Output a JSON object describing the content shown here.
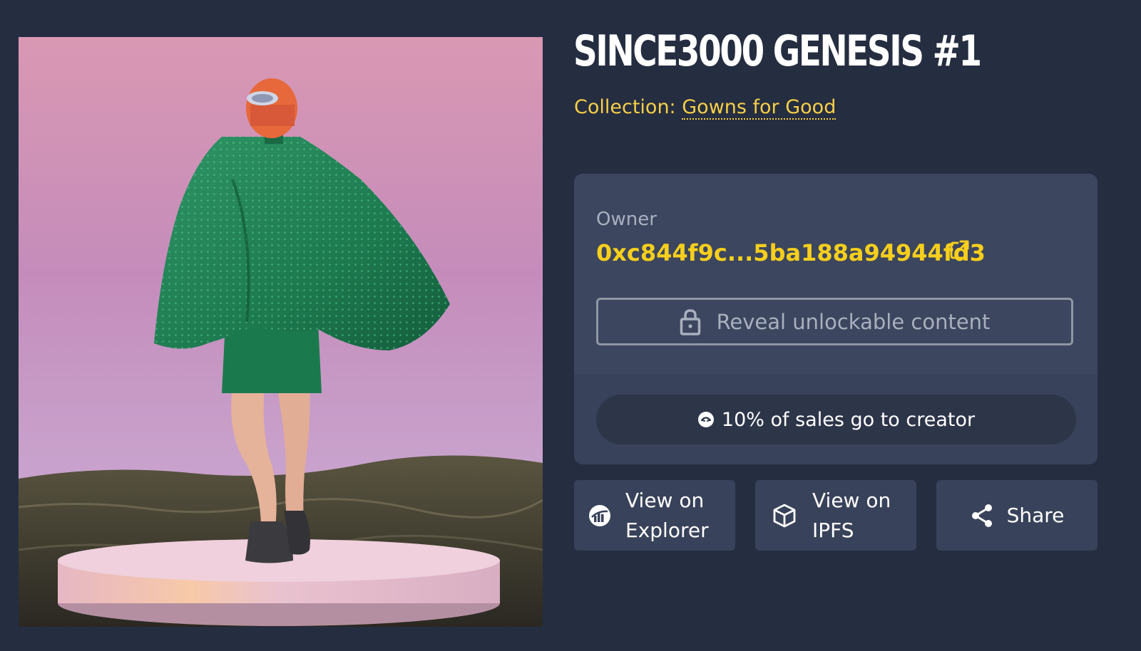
{
  "nft": {
    "title": "SINCE3000 GENESIS #1",
    "collection_prefix": "Collection:",
    "collection_name": "Gowns for Good"
  },
  "owner": {
    "label": "Owner",
    "address": "0xc844f9c...5ba188a94944fd3"
  },
  "unlockable": {
    "label": "Reveal unlockable content"
  },
  "royalty": {
    "text": "10% of sales go to creator"
  },
  "actions": [
    {
      "line1": "View on",
      "line2": "Explorer",
      "icon": "explorer-icon"
    },
    {
      "line1": "View on",
      "line2": "IPFS",
      "icon": "cube-icon"
    },
    {
      "label": "Share",
      "icon": "share-icon"
    }
  ],
  "colors": {
    "background": "#252d41",
    "card": "#38425a",
    "accent_yellow": "#f7cf1c",
    "collection_yellow": "#f7cf46"
  }
}
